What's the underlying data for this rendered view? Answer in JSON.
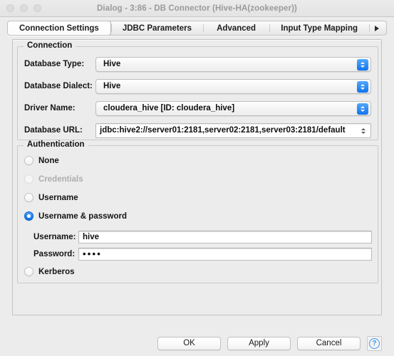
{
  "window": {
    "title": "Dialog - 3:86 - DB Connector (Hive-HA(zookeeper))",
    "traffic_lights": [
      "close",
      "minimize",
      "zoom"
    ],
    "state": "inactive"
  },
  "tabs": [
    {
      "label": "Connection Settings",
      "active": true
    },
    {
      "label": "JDBC Parameters",
      "active": false
    },
    {
      "label": "Advanced",
      "active": false
    },
    {
      "label": "Input Type Mapping",
      "active": false
    }
  ],
  "tab_overflow_icon": "right-arrow-icon",
  "connection": {
    "legend": "Connection",
    "fields": [
      {
        "label": "Database Type:",
        "value": "Hive",
        "type": "combo"
      },
      {
        "label": "Database Dialect:",
        "value": "Hive",
        "type": "combo"
      },
      {
        "label": "Driver Name:",
        "value": "cloudera_hive [ID: cloudera_hive]",
        "type": "combo"
      },
      {
        "label": "Database URL:",
        "value": "jdbc:hive2://server01:2181,server02:2181,server03:2181/default",
        "type": "editable-combo"
      }
    ]
  },
  "authentication": {
    "legend": "Authentication",
    "options": [
      {
        "label": "None",
        "selected": false,
        "disabled": false
      },
      {
        "label": "Credentials",
        "selected": false,
        "disabled": true
      },
      {
        "label": "Username",
        "selected": false,
        "disabled": false
      },
      {
        "label": "Username & password",
        "selected": true,
        "disabled": false
      },
      {
        "label": "Kerberos",
        "selected": false,
        "disabled": false
      }
    ],
    "credentials": {
      "username_label": "Username:",
      "username_value": "hive",
      "password_label": "Password:",
      "password_value": "••••"
    }
  },
  "buttons": {
    "ok": "OK",
    "apply": "Apply",
    "cancel": "Cancel",
    "help": "?"
  },
  "colors": {
    "accent_blue": "#1074f0",
    "window_bg": "#ececec",
    "title_text": "#9a9a9a",
    "disabled_text": "#adadad"
  }
}
